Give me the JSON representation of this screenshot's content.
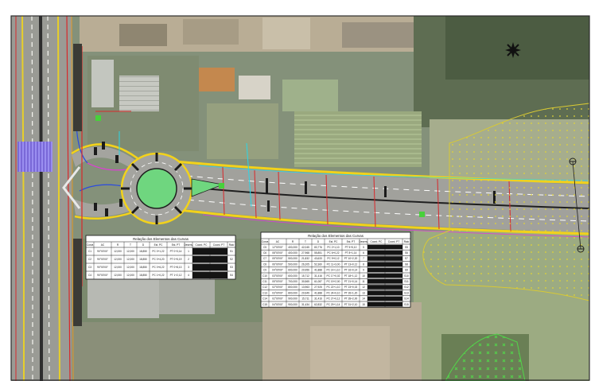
{
  "drawing": {
    "colors": {
      "aerial_base": "#7d8a6d",
      "field_green": "#8fa17a",
      "forest_dark": "#4f5f45",
      "soil": "#b7a992",
      "pavement": "#9b9b95",
      "road_edge_yellow": "#f2d21b",
      "roundabout_green": "#6fd67f",
      "accent_red": "#d8282b",
      "accent_magenta": "#e23ad8",
      "accent_cyan": "#2ad6e8",
      "accent_blue": "#2a4be0",
      "crosswalk_purple": "#7a69d8",
      "table_bg": "#ffffff",
      "table_ink": "#111111",
      "table_dark_cell": "#141414"
    },
    "icons": {
      "north_arrow": "north-arrow-icon",
      "monument_marker": "survey-marker-icon"
    }
  },
  "tables": {
    "left": {
      "title": "Relação dos Elementos das Curvas",
      "headers": [
        "Curva",
        "AC",
        "R",
        "T",
        "D",
        "Est. PC",
        "Est. PT",
        "Desenv.",
        "Coord. PC",
        "Coord. PT",
        "Raio"
      ],
      "rows": [
        [
          "C1",
          "90°00'00\"",
          "12,000",
          "12,000",
          "18,850",
          "PC 0+1,22",
          "PT 0+3,14",
          "1",
          "",
          "",
          "S1"
        ],
        [
          "C2",
          "90°00'00\"",
          "12,000",
          "12,000",
          "18,850",
          "PC 0+4,20",
          "PT 0+5,19",
          "2",
          "",
          "",
          "S2"
        ],
        [
          "C3",
          "90°00'00\"",
          "12,000",
          "12,000",
          "18,850",
          "PC 0+6,22",
          "PT 0+8,13",
          "3",
          "",
          "",
          "S3"
        ],
        [
          "C4",
          "90°00'00\"",
          "12,000",
          "12,000",
          "18,850",
          "PC 1+0,22",
          "PT 1+2,12",
          "4",
          "",
          "",
          "S4"
        ]
      ]
    },
    "right": {
      "title": "Relação dos Elementos das Curvas",
      "headers": [
        "Curva",
        "AC",
        "R",
        "T",
        "D",
        "Est. PC",
        "Est. PT",
        "Desenv.",
        "Coord. PC",
        "Coord. PT",
        "Raio"
      ],
      "rows": [
        [
          "C5",
          "12°00'00\"",
          "400,000",
          "42,045",
          "83,776",
          "PC 2+1,10",
          "PT 5+5,10",
          "5",
          "",
          "",
          "S5"
        ],
        [
          "C6",
          "08°00'00\"",
          "400,000",
          "27,968",
          "55,851",
          "PC 6+0,22",
          "PT 8+1,14",
          "6",
          "",
          "",
          "S6"
        ],
        [
          "C7",
          "05°00'00\"",
          "500,000",
          "21,832",
          "43,633",
          "PC 9+0,12",
          "PT 10+2,20",
          "7",
          "",
          "",
          "S7"
        ],
        [
          "C8",
          "06°00'00\"",
          "500,000",
          "26,205",
          "52,360",
          "PC 11+3,00",
          "PT 13+0,12",
          "8",
          "",
          "",
          "S8"
        ],
        [
          "C9",
          "04°00'00\"",
          "600,000",
          "20,956",
          "41,888",
          "PC 14+1,10",
          "PT 16+0,14",
          "9",
          "",
          "",
          "S9"
        ],
        [
          "C10",
          "03°00'00\"",
          "600,000",
          "15,712",
          "31,416",
          "PC 17+0,02",
          "PT 18+1,12",
          "10",
          "",
          "",
          "S10"
        ],
        [
          "C11",
          "05°00'00\"",
          "700,000",
          "30,565",
          "61,087",
          "PC 19+2,00",
          "PT 21+0,14",
          "11",
          "",
          "",
          "S11"
        ],
        [
          "C12",
          "02°00'00\"",
          "800,000",
          "13,963",
          "27,925",
          "PC 22+1,10",
          "PT 23+0,02",
          "12",
          "",
          "",
          "S12"
        ],
        [
          "C13",
          "03°00'00\"",
          "800,000",
          "20,949",
          "41,888",
          "PC 24+0,10",
          "PT 26+1,20",
          "13",
          "",
          "",
          "S13"
        ],
        [
          "C14",
          "02°00'00\"",
          "900,000",
          "15,711",
          "31,416",
          "PC 27+0,12",
          "PT 28+2,00",
          "14",
          "",
          "",
          "S14"
        ],
        [
          "C15",
          "04°00'00\"",
          "900,000",
          "31,434",
          "62,832",
          "PC 29+1,14",
          "PT 31+2,10",
          "15",
          "",
          "",
          "S15"
        ]
      ]
    }
  }
}
